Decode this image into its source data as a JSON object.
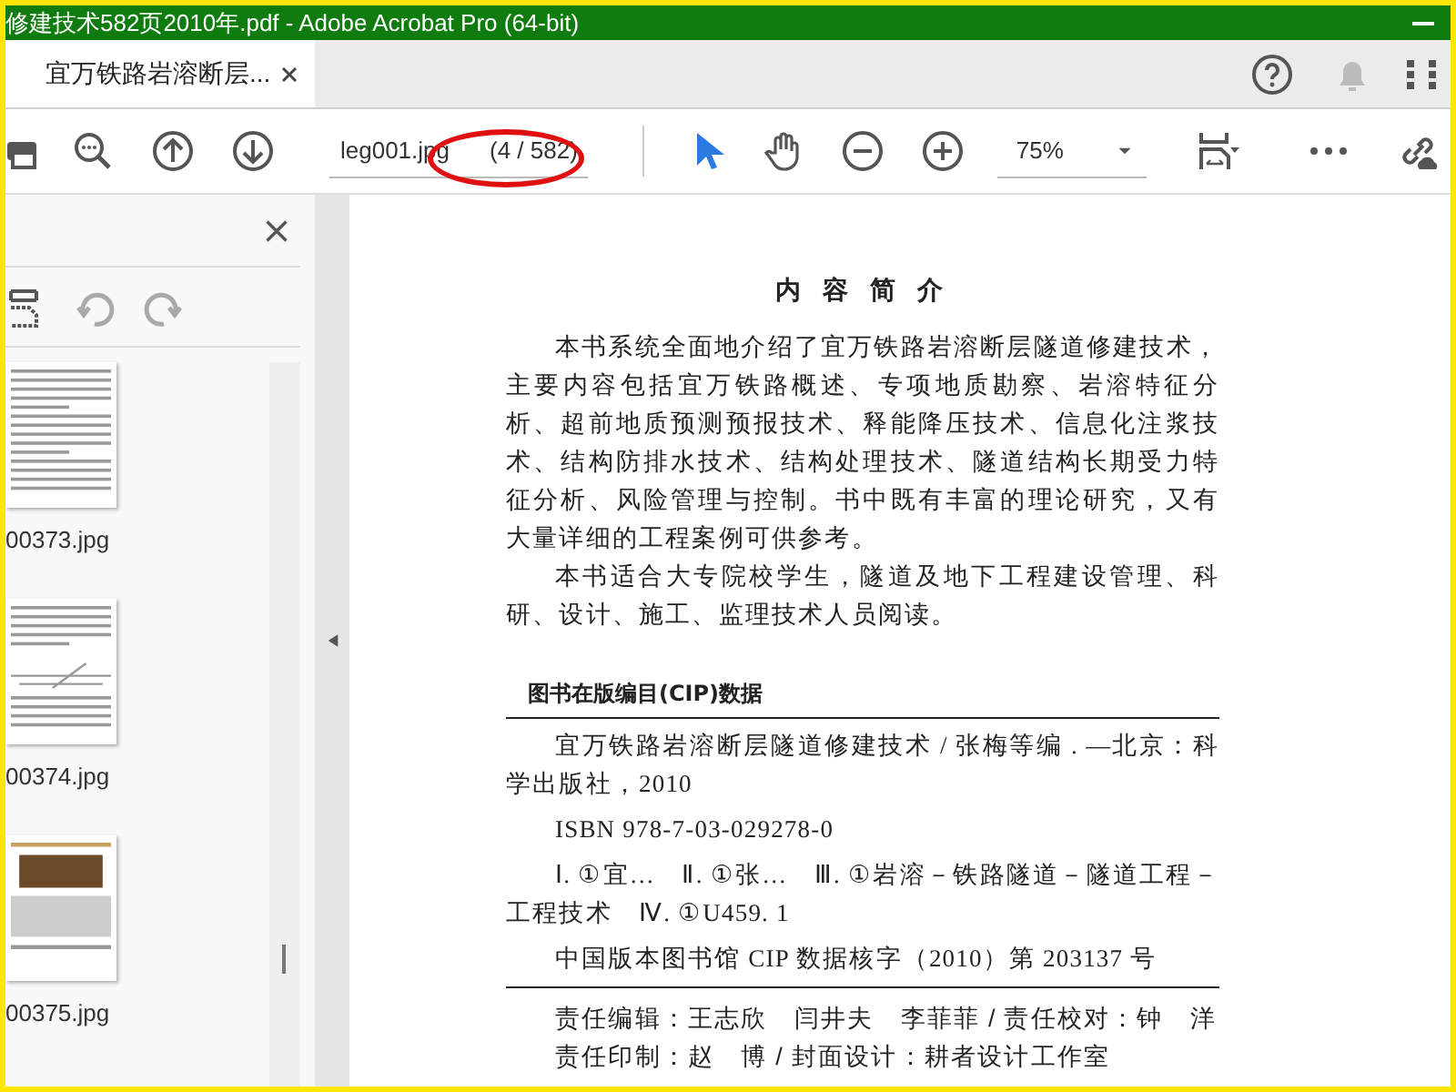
{
  "window": {
    "title": "修建技术582页2010年.pdf - Adobe Acrobat Pro (64-bit)"
  },
  "tabs": [
    {
      "label": "宜万铁路岩溶断层...",
      "selected": true
    }
  ],
  "toolbar": {
    "page_field": {
      "value": "leg001.jpg",
      "page_count": "(4 / 582)"
    },
    "tools": [
      {
        "kind": "select",
        "selected": true
      },
      {
        "kind": "hand",
        "selected": false
      }
    ],
    "zoom": "75%"
  },
  "sidebar": {
    "thumbnails": [
      {
        "label": "00373.jpg",
        "kind": "text"
      },
      {
        "label": "00374.jpg",
        "kind": "figure"
      },
      {
        "label": "00375.jpg",
        "kind": "photo"
      }
    ]
  },
  "document": {
    "heading": "内 容 简 介",
    "paragraphs": [
      "本书系统全面地介绍了宜万铁路岩溶断层隧道修建技术，主要内容包括宜万铁路概述、专项地质勘察、岩溶特征分析、超前地质预测预报技术、释能降压技术、信息化注浆技术、结构防排水技术、结构处理技术、隧道结构长期受力特征分析、风险管理与控制。书中既有丰富的理论研究，又有大量详细的工程案例可供参考。",
      "本书适合大专院校学生，隧道及地下工程建设管理、科研、设计、施工、监理技术人员阅读。"
    ],
    "cip_title": "图书在版编目(CIP)数据",
    "cip_lines": [
      "宜万铁路岩溶断层隧道修建技术 / 张梅等编 . —北京：科学出版社，2010",
      "ISBN 978-7-03-029278-0",
      "Ⅰ. ①宜…　Ⅱ. ①张…　Ⅲ. ①岩溶－铁路隧道－隧道工程－工程技术　Ⅳ. ①U459. 1"
    ],
    "cip_number": "中国版本图书馆 CIP 数据核字（2010）第 203137 号",
    "credits": [
      "责任编辑：王志欣　闫井夫　李菲菲 / 责任校对：钟　洋",
      "责任印制：赵　博 / 封面设计：耕者设计工作室"
    ]
  }
}
